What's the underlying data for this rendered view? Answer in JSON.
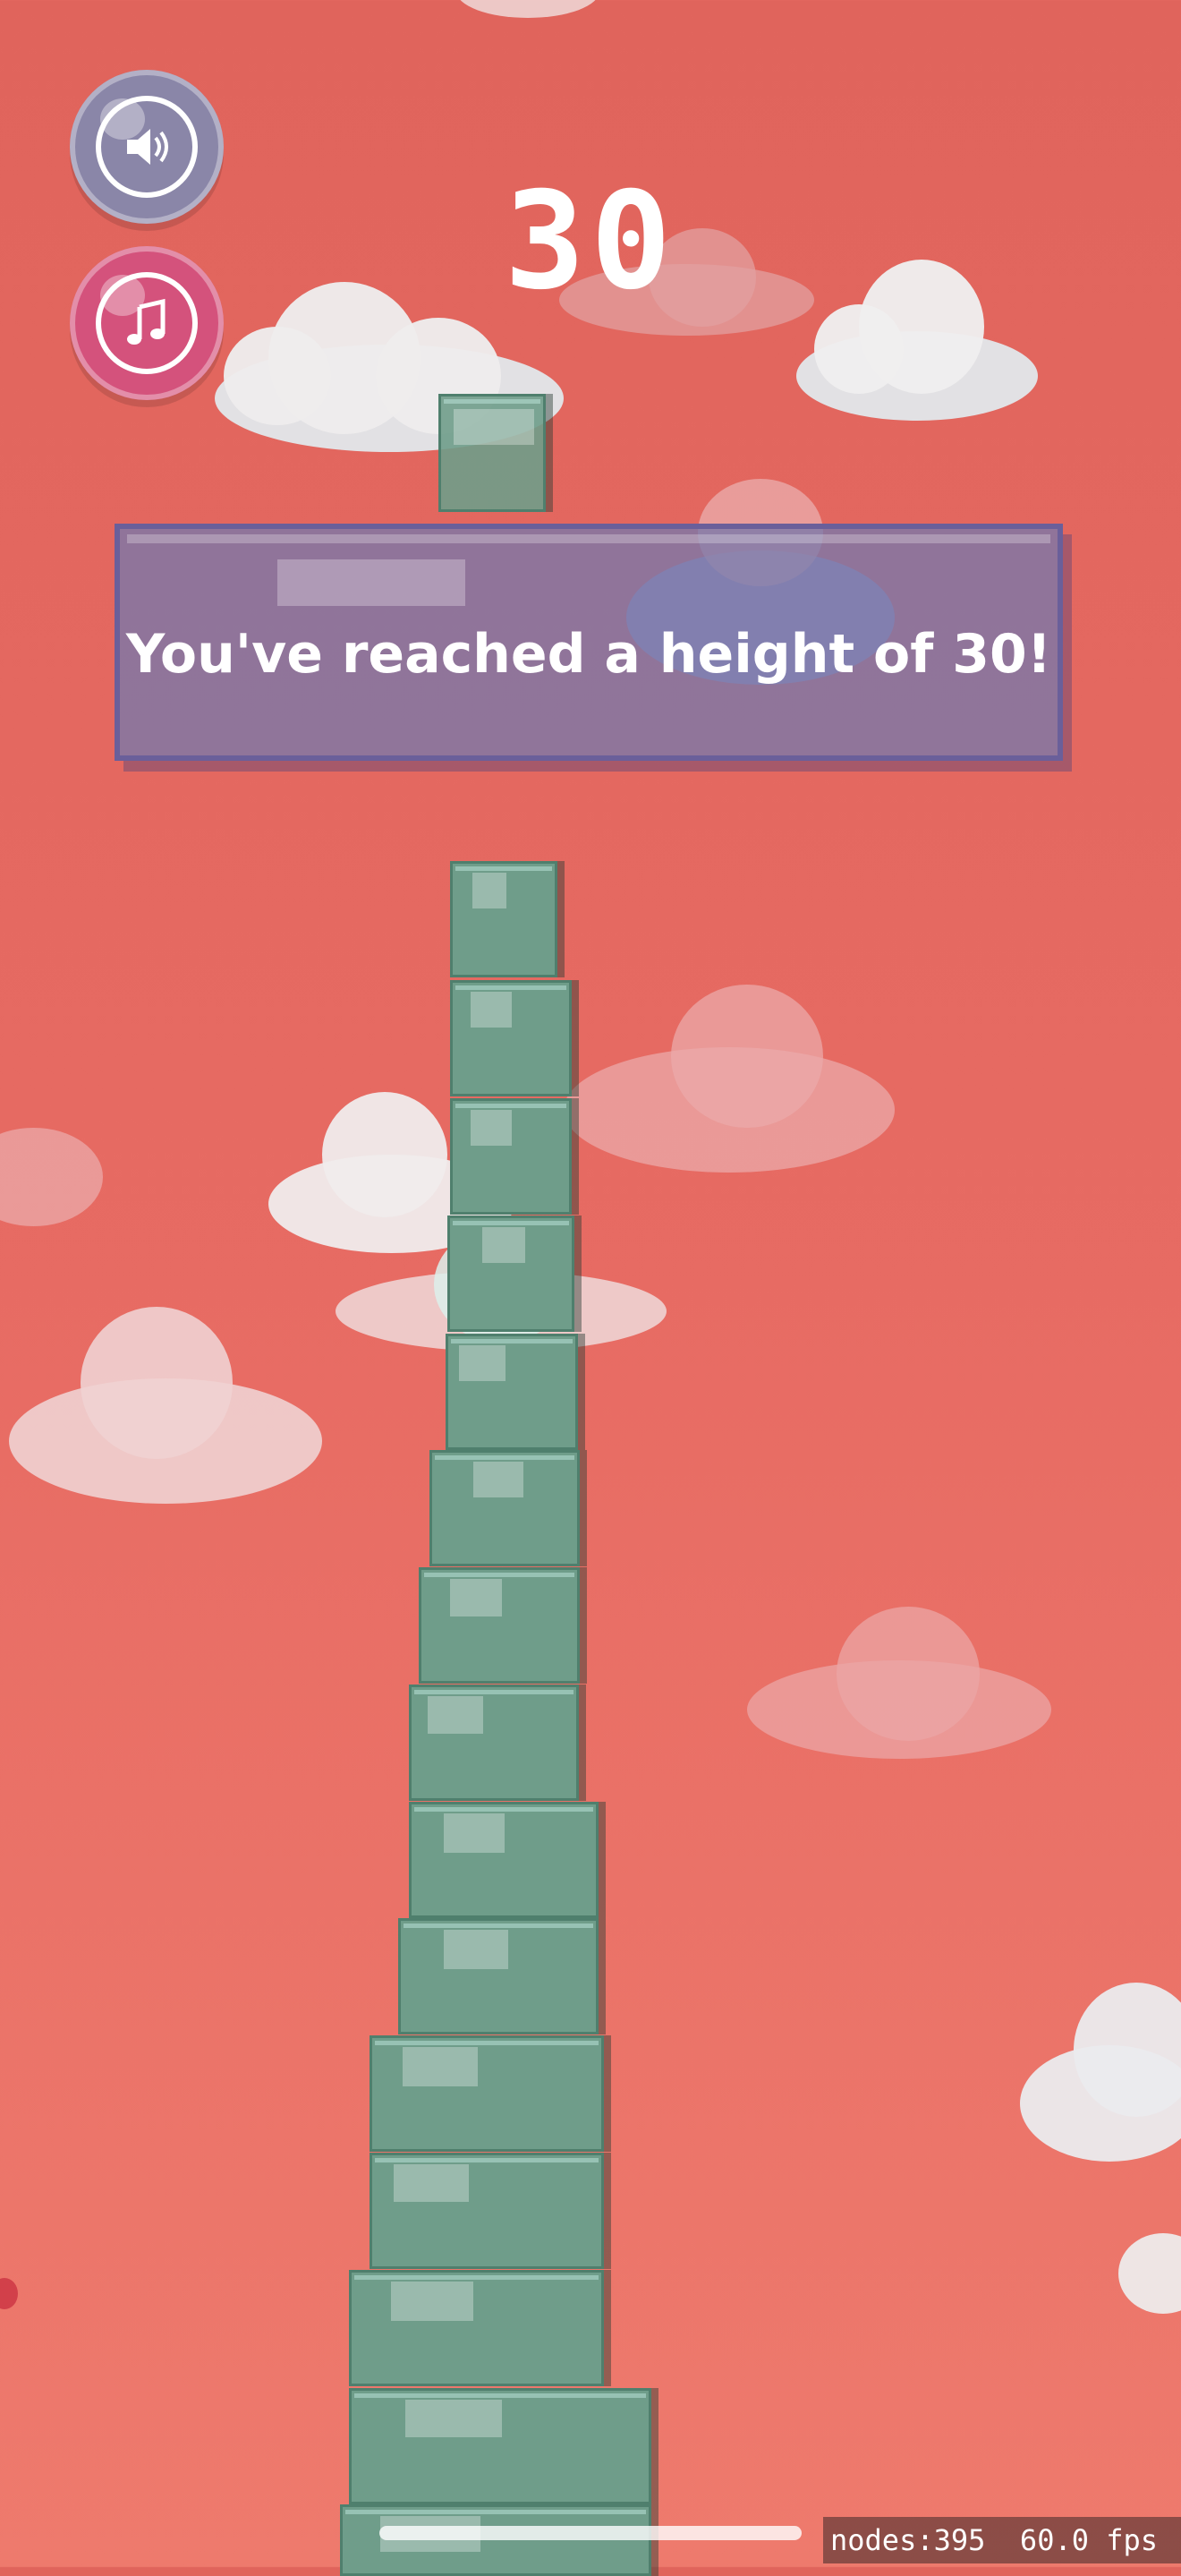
{
  "game": {
    "score": "30",
    "message": "You've reached a height of 30!",
    "colors": {
      "background": "#e76b63",
      "block": "#6f9d8a",
      "banner": "#7a78a8",
      "sound_button": "#8a86a8",
      "music_button": "#d4527c"
    }
  },
  "controls": {
    "sound_icon": "speaker-icon",
    "music_icon": "music-note-icon"
  },
  "debug": {
    "nodes_label": "nodes:395",
    "fps_label": "60.0 fps"
  }
}
